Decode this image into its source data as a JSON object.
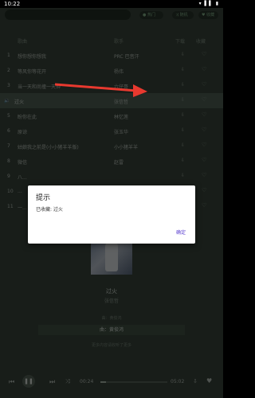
{
  "status": {
    "time": "10:22",
    "icons": "▾ ▌▌ ▮"
  },
  "topbar": {
    "search_placeholder": "",
    "hot_label": "热门",
    "random_label": "随机",
    "fav_label": "收藏"
  },
  "header": {
    "song": "歌曲",
    "artist": "歌手",
    "download": "下载",
    "favorite": "收藏"
  },
  "songs": [
    {
      "num": "1",
      "title": "想你想你想我",
      "artist": "PRC 巴音汗",
      "active": false
    },
    {
      "num": "2",
      "title": "等风你等花开",
      "artist": "杨伟",
      "active": false
    },
    {
      "num": "3",
      "title": "当一天和尚撞一天钟",
      "artist": "六仔哥",
      "active": false
    },
    {
      "num": "",
      "title": "过火",
      "artist": "张信哲",
      "active": true
    },
    {
      "num": "5",
      "title": "盼你在此",
      "artist": "林忆莲",
      "active": false
    },
    {
      "num": "6",
      "title": "原谅",
      "artist": "张玉华",
      "active": false
    },
    {
      "num": "7",
      "title": "姑娘我之前是(小小猪羊羊版)",
      "artist": "小小猪羊羊",
      "active": false
    },
    {
      "num": "8",
      "title": "微信",
      "artist": "赵雷",
      "active": false
    },
    {
      "num": "9",
      "title": "八...",
      "artist": "",
      "active": false
    },
    {
      "num": "10",
      "title": "...",
      "artist": "",
      "active": false
    },
    {
      "num": "11",
      "title": "一...",
      "artist": "",
      "active": false
    }
  ],
  "row_icons": {
    "download": "⇩",
    "heart": "♡"
  },
  "now_playing": {
    "title": "过火",
    "artist": "张信哲",
    "lyric_prev": "曲：黄俊鸿",
    "lyric_current": "曲：黄俊鸿",
    "lyric_next": "更多内容请收听了更多"
  },
  "player": {
    "current_time": "00:24",
    "total_time": "05:02",
    "progress": 0.08
  },
  "dialog": {
    "title": "提示",
    "message": "已收藏: 过火",
    "ok_label": "确定"
  },
  "colors": {
    "accent": "#5b3fd0",
    "arrow": "#e8392f"
  }
}
